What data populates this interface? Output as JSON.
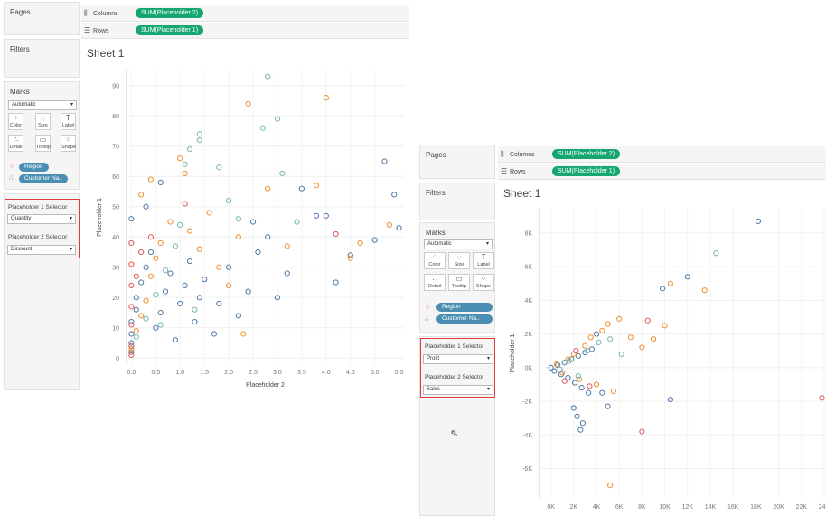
{
  "left": {
    "pages_label": "Pages",
    "filters_label": "Filters",
    "marks_label": "Marks",
    "mark_type": "Automatic",
    "buttons": [
      "Color",
      "Size",
      "Label",
      "Detail",
      "Tooltip",
      "Shape"
    ],
    "fields": [
      "Region",
      "Customer Na.."
    ],
    "columns_label": "Columns",
    "rows_label": "Rows",
    "columns_pill": "SUM(Placeholder 2)",
    "rows_pill": "SUM(Placeholder 1)",
    "sheet_title": "Sheet 1",
    "sel1_label": "Placeholder 1 Selector",
    "sel1_value": "Quantity",
    "sel2_label": "Placeholder 2 Selector",
    "sel2_value": "Discount"
  },
  "right": {
    "pages_label": "Pages",
    "filters_label": "Filters",
    "marks_label": "Marks",
    "mark_type": "Automatic",
    "buttons": [
      "Color",
      "Size",
      "Label",
      "Detail",
      "Tooltip",
      "Shape"
    ],
    "fields": [
      "Region",
      "Customer Na.."
    ],
    "columns_label": "Columns",
    "rows_label": "Rows",
    "columns_pill": "SUM(Placeholder 2)",
    "rows_pill": "SUM(Placeholder 1)",
    "sheet_title": "Sheet 1",
    "sel1_label": "Placeholder 1 Selector",
    "sel1_value": "Profit",
    "sel2_label": "Placeholder 2 Selector",
    "sel2_value": "Sales"
  },
  "colors": {
    "pill_green": "#16a771",
    "field_blue": "#4a8fb3",
    "highlight_red": "#e03a3a",
    "series": [
      "#4e79a7",
      "#f28e2b",
      "#76b7b2",
      "#e15759"
    ]
  },
  "chart_data": [
    {
      "type": "scatter",
      "xlabel": "Placeholder 2",
      "ylabel": "Placeholder 1",
      "xlim": [
        -0.1,
        5.6
      ],
      "ylim": [
        -2,
        95
      ],
      "xticks": [
        "0.0",
        "0.5",
        "1.0",
        "1.5",
        "2.0",
        "2.5",
        "3.0",
        "3.5",
        "4.0",
        "4.5",
        "5.0",
        "5.5"
      ],
      "yticks": [
        "0",
        "10",
        "20",
        "30",
        "40",
        "50",
        "60",
        "70",
        "80",
        "90"
      ],
      "series": [
        {
          "color": "#4e79a7",
          "points": [
            [
              0,
              2
            ],
            [
              0,
              5
            ],
            [
              0,
              8
            ],
            [
              0,
              12
            ],
            [
              0.1,
              16
            ],
            [
              0.1,
              20
            ],
            [
              0.2,
              25
            ],
            [
              0.3,
              30
            ],
            [
              0.4,
              35
            ],
            [
              0.5,
              10
            ],
            [
              0.6,
              15
            ],
            [
              0.7,
              22
            ],
            [
              0.8,
              28
            ],
            [
              0.9,
              6
            ],
            [
              1.0,
              18
            ],
            [
              1.1,
              24
            ],
            [
              1.2,
              32
            ],
            [
              1.3,
              12
            ],
            [
              1.4,
              20
            ],
            [
              1.5,
              26
            ],
            [
              1.7,
              8
            ],
            [
              1.8,
              18
            ],
            [
              2.0,
              30
            ],
            [
              2.2,
              14
            ],
            [
              2.4,
              22
            ],
            [
              2.6,
              35
            ],
            [
              2.8,
              40
            ],
            [
              3.0,
              20
            ],
            [
              3.2,
              28
            ],
            [
              3.5,
              56
            ],
            [
              3.8,
              47
            ],
            [
              4.0,
              47
            ],
            [
              4.2,
              25
            ],
            [
              4.5,
              34
            ],
            [
              5.0,
              39
            ],
            [
              5.2,
              65
            ],
            [
              5.4,
              54
            ],
            [
              5.5,
              43
            ],
            [
              0.0,
              46
            ],
            [
              0.3,
              50
            ],
            [
              0.6,
              58
            ],
            [
              2.5,
              45
            ]
          ]
        },
        {
          "color": "#f28e2b",
          "points": [
            [
              0,
              3
            ],
            [
              0.1,
              9
            ],
            [
              0.2,
              14
            ],
            [
              0.2,
              54
            ],
            [
              0.3,
              19
            ],
            [
              0.4,
              27
            ],
            [
              0.4,
              59
            ],
            [
              0.5,
              33
            ],
            [
              0.6,
              38
            ],
            [
              0.8,
              45
            ],
            [
              1.0,
              66
            ],
            [
              1.1,
              61
            ],
            [
              1.2,
              42
            ],
            [
              1.4,
              36
            ],
            [
              1.6,
              48
            ],
            [
              1.8,
              30
            ],
            [
              2.0,
              24
            ],
            [
              2.2,
              40
            ],
            [
              2.3,
              8
            ],
            [
              2.4,
              84
            ],
            [
              2.8,
              56
            ],
            [
              3.2,
              37
            ],
            [
              3.8,
              57
            ],
            [
              4.0,
              86
            ],
            [
              4.5,
              33
            ],
            [
              4.7,
              38
            ],
            [
              5.3,
              44
            ]
          ]
        },
        {
          "color": "#76b7b2",
          "points": [
            [
              0.1,
              7
            ],
            [
              0.3,
              13
            ],
            [
              0.5,
              21
            ],
            [
              0.7,
              29
            ],
            [
              0.9,
              37
            ],
            [
              1.0,
              44
            ],
            [
              1.1,
              64
            ],
            [
              1.2,
              69
            ],
            [
              1.4,
              74
            ],
            [
              1.4,
              72
            ],
            [
              1.8,
              63
            ],
            [
              2.0,
              52
            ],
            [
              2.2,
              46
            ],
            [
              2.7,
              76
            ],
            [
              2.8,
              93
            ],
            [
              3.0,
              79
            ],
            [
              3.1,
              61
            ],
            [
              3.4,
              45
            ],
            [
              0.6,
              11
            ],
            [
              1.3,
              16
            ]
          ]
        },
        {
          "color": "#e15759",
          "points": [
            [
              0,
              1
            ],
            [
              0,
              4
            ],
            [
              0,
              11
            ],
            [
              0,
              17
            ],
            [
              0,
              24
            ],
            [
              0,
              31
            ],
            [
              0,
              38
            ],
            [
              0.1,
              27
            ],
            [
              0.2,
              35
            ],
            [
              0.4,
              40
            ],
            [
              4.2,
              41
            ],
            [
              1.1,
              51
            ]
          ]
        }
      ]
    },
    {
      "type": "scatter",
      "xlabel": "",
      "ylabel": "Placeholder 1",
      "xlim": [
        -1000,
        24000
      ],
      "ylim": [
        -7800,
        9500
      ],
      "xticks": [
        "0K",
        "2K",
        "4K",
        "6K",
        "8K",
        "10K",
        "12K",
        "14K",
        "16K",
        "18K",
        "20K",
        "22K",
        "24K"
      ],
      "yticks": [
        "-6K",
        "-4K",
        "-2K",
        "0K",
        "2K",
        "4K",
        "6K",
        "8K"
      ],
      "series": [
        {
          "color": "#4e79a7",
          "points": [
            [
              0,
              0
            ],
            [
              300,
              -200
            ],
            [
              600,
              150
            ],
            [
              900,
              -400
            ],
            [
              1200,
              300
            ],
            [
              1500,
              -600
            ],
            [
              1800,
              500
            ],
            [
              2100,
              -900
            ],
            [
              2400,
              700
            ],
            [
              2700,
              -1200
            ],
            [
              3000,
              900
            ],
            [
              3300,
              -1500
            ],
            [
              3600,
              1100
            ],
            [
              2000,
              -2400
            ],
            [
              2300,
              -2900
            ],
            [
              2600,
              -3700
            ],
            [
              2800,
              -3300
            ],
            [
              4500,
              -1500
            ],
            [
              10500,
              -1900
            ],
            [
              9800,
              4700
            ],
            [
              12000,
              5400
            ],
            [
              18200,
              8700
            ],
            [
              4000,
              2000
            ],
            [
              5000,
              -2300
            ]
          ]
        },
        {
          "color": "#f28e2b",
          "points": [
            [
              500,
              200
            ],
            [
              1000,
              -300
            ],
            [
              1500,
              500
            ],
            [
              2000,
              800
            ],
            [
              2500,
              -700
            ],
            [
              3000,
              1300
            ],
            [
              3500,
              1800
            ],
            [
              4000,
              -1000
            ],
            [
              4500,
              2200
            ],
            [
              5000,
              2600
            ],
            [
              5500,
              -1400
            ],
            [
              6000,
              2900
            ],
            [
              7000,
              1800
            ],
            [
              8000,
              1200
            ],
            [
              9000,
              1700
            ],
            [
              10000,
              2500
            ],
            [
              10500,
              5000
            ],
            [
              13500,
              4600
            ],
            [
              5200,
              -7000
            ]
          ]
        },
        {
          "color": "#76b7b2",
          "points": [
            [
              800,
              -100
            ],
            [
              1600,
              400
            ],
            [
              2400,
              -500
            ],
            [
              3200,
              1000
            ],
            [
              4200,
              1500
            ],
            [
              5200,
              1700
            ],
            [
              6200,
              800
            ],
            [
              14500,
              6800
            ]
          ]
        },
        {
          "color": "#e15759",
          "points": [
            [
              1200,
              -800
            ],
            [
              2200,
              1000
            ],
            [
              3400,
              -1100
            ],
            [
              8000,
              -3800
            ],
            [
              8500,
              2800
            ],
            [
              23800,
              -1800
            ]
          ]
        }
      ]
    }
  ]
}
